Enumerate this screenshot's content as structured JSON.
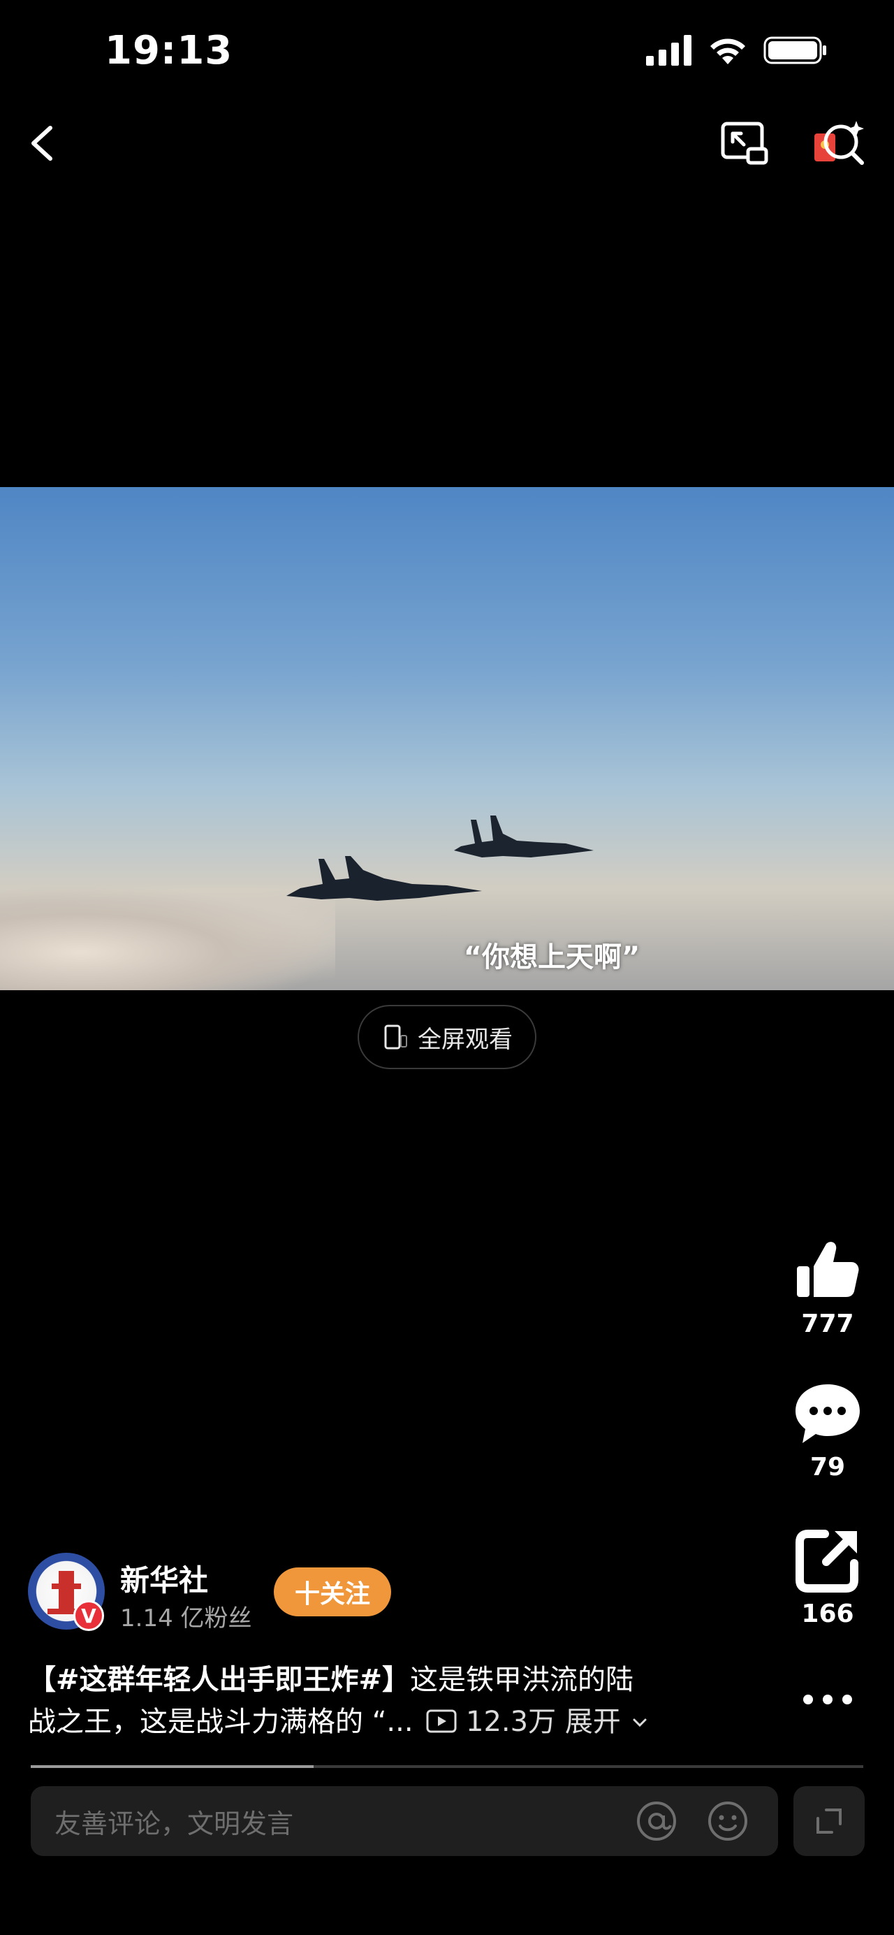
{
  "status_bar": {
    "time": "19:13"
  },
  "video": {
    "subtitle": "“你想上天啊”"
  },
  "fullscreen": {
    "label": "全屏观看"
  },
  "actions": {
    "like_count": "777",
    "comment_count": "79",
    "share_count": "166"
  },
  "author": {
    "name": "新华社",
    "fans": "1.14 亿粉丝",
    "follow_label": "十关注",
    "badge": "V"
  },
  "caption": {
    "hashtag": "【#这群年轻人出手即王炸#】",
    "text_line1": "这是铁甲洪流的陆",
    "text_line2": "战之王，这是战斗力满格的 “...",
    "views": "12.3万",
    "expand": "展开"
  },
  "progress": {
    "played_fraction": 0.34
  },
  "comment": {
    "placeholder": "友善评论，文明发言"
  },
  "icons": [
    "back-icon",
    "pip-icon",
    "red-envelope-search-icon",
    "thumbs-up-icon",
    "comment-icon",
    "share-icon",
    "more-icon",
    "at-icon",
    "emoji-icon",
    "expand-icon",
    "phone-icon",
    "play-icon",
    "chevron-down-icon"
  ]
}
